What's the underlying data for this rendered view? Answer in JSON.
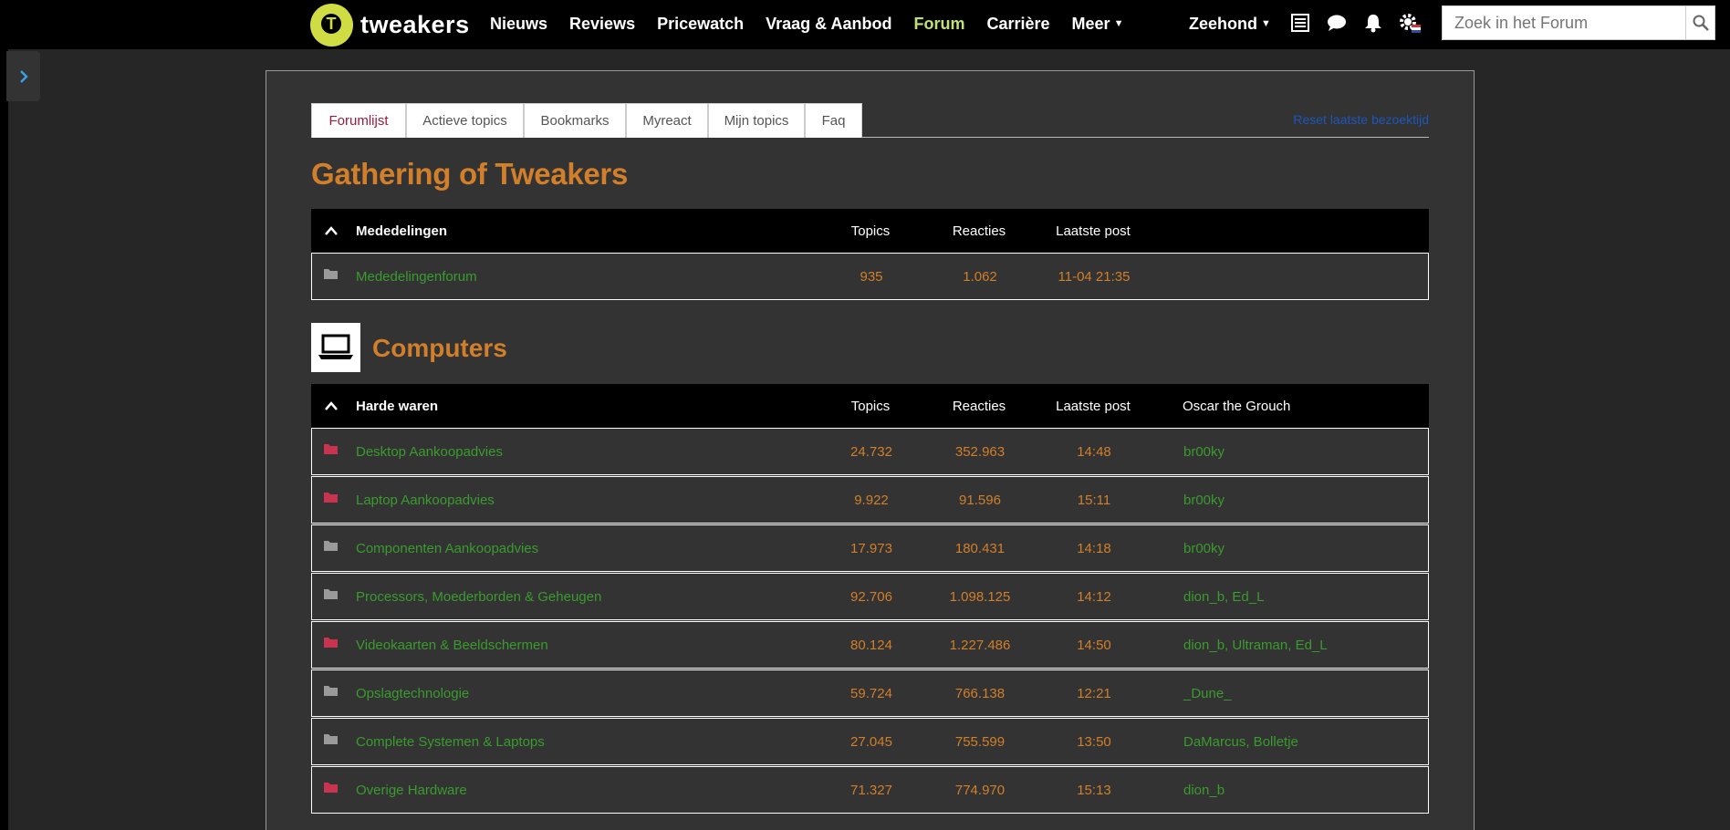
{
  "brand": {
    "name": "tweakers",
    "logo_letter": "T",
    "accent": "#d0dc44"
  },
  "nav": {
    "items": [
      {
        "label": "Nieuws",
        "active": false
      },
      {
        "label": "Reviews",
        "active": false
      },
      {
        "label": "Pricewatch",
        "active": false
      },
      {
        "label": "Vraag & Aanbod",
        "active": false
      },
      {
        "label": "Forum",
        "active": true
      },
      {
        "label": "Carrière",
        "active": false
      },
      {
        "label": "Meer",
        "active": false,
        "dropdown": true
      }
    ]
  },
  "user": {
    "name": "Zeehond"
  },
  "header_icons": [
    "list-icon",
    "chat-icon",
    "bell-icon",
    "gear-icon"
  ],
  "search": {
    "placeholder": "Zoek in het Forum",
    "value": ""
  },
  "tabs": [
    {
      "label": "Forumlijst",
      "active": true
    },
    {
      "label": "Actieve topics",
      "active": false
    },
    {
      "label": "Bookmarks",
      "active": false
    },
    {
      "label": "Myreact",
      "active": false
    },
    {
      "label": "Mijn topics",
      "active": false
    },
    {
      "label": "Faq",
      "active": false
    }
  ],
  "reset_link": "Reset laatste bezoektijd",
  "page_title": "Gathering of Tweakers",
  "section_computers": {
    "title": "Computers",
    "icon": "laptop-icon"
  },
  "colors": {
    "orange": "#d17f2a",
    "green": "#3a9b2e",
    "folder_new": "#c8344f",
    "folder_old": "#9a9a9a"
  },
  "table_mededelingen": {
    "title": "Mededelingen",
    "columns": {
      "topics": "Topics",
      "reacties": "Reacties",
      "laatste": "Laatste post",
      "mods": ""
    },
    "rows": [
      {
        "name": "Mededelingenforum",
        "topics": "935",
        "reacties": "1.062",
        "laatste": "11-04 21:35",
        "mods": "",
        "new": false
      }
    ]
  },
  "table_harde_waren": {
    "title": "Harde waren",
    "columns": {
      "topics": "Topics",
      "reacties": "Reacties",
      "laatste": "Laatste post",
      "mods": "Oscar the Grouch"
    },
    "rows": [
      {
        "name": "Desktop Aankoopadvies",
        "topics": "24.732",
        "reacties": "352.963",
        "laatste": "14:48",
        "mods": "br00ky",
        "new": true
      },
      {
        "name": "Laptop Aankoopadvies",
        "topics": "9.922",
        "reacties": "91.596",
        "laatste": "15:11",
        "mods": "br00ky",
        "new": true
      },
      {
        "name": "Componenten Aankoopadvies",
        "topics": "17.973",
        "reacties": "180.431",
        "laatste": "14:18",
        "mods": "br00ky",
        "new": false
      },
      {
        "name": "Processors, Moederborden & Geheugen",
        "topics": "92.706",
        "reacties": "1.098.125",
        "laatste": "14:12",
        "mods": "dion_b, Ed_L",
        "new": false
      },
      {
        "name": "Videokaarten & Beeldschermen",
        "topics": "80.124",
        "reacties": "1.227.486",
        "laatste": "14:50",
        "mods": "dion_b, Ultraman, Ed_L",
        "new": true
      },
      {
        "name": "Opslagtechnologie",
        "topics": "59.724",
        "reacties": "766.138",
        "laatste": "12:21",
        "mods": "_Dune_",
        "new": false
      },
      {
        "name": "Complete Systemen & Laptops",
        "topics": "27.045",
        "reacties": "755.599",
        "laatste": "13:50",
        "mods": "DaMarcus, Bolletje",
        "new": false
      },
      {
        "name": "Overige Hardware",
        "topics": "71.327",
        "reacties": "774.970",
        "laatste": "15:13",
        "mods": "dion_b",
        "new": true
      }
    ]
  }
}
